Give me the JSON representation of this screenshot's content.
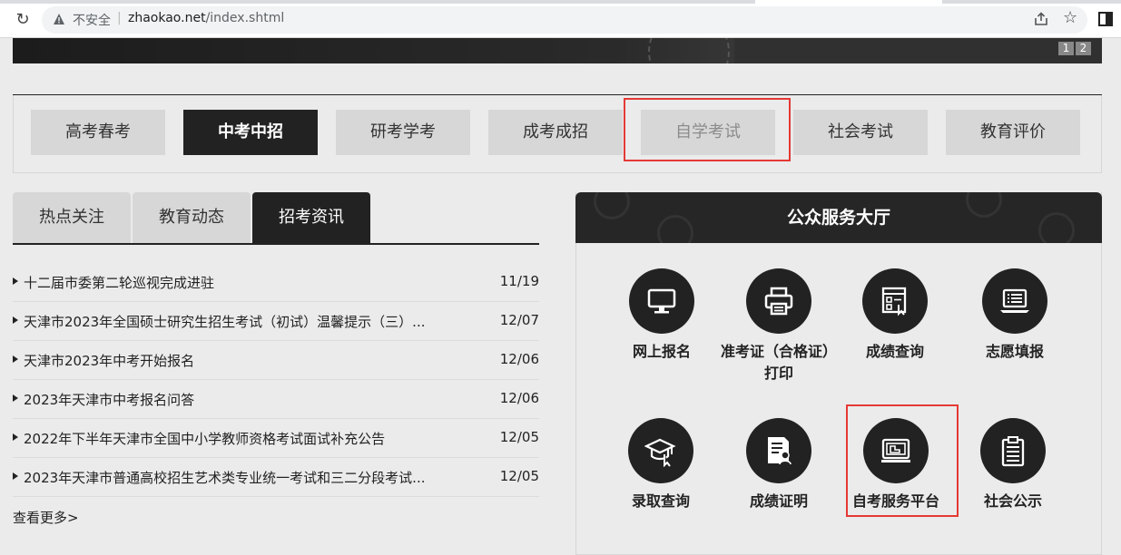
{
  "browser": {
    "insecure_label": "不安全",
    "separator": "|",
    "url_host": "zhaokao.net",
    "url_path": "/index.shtml"
  },
  "banner": {
    "pager": [
      "1",
      "2"
    ]
  },
  "categories": [
    {
      "label": "高考春考",
      "state": "normal"
    },
    {
      "label": "中考中招",
      "state": "active"
    },
    {
      "label": "研考学考",
      "state": "normal"
    },
    {
      "label": "成考成招",
      "state": "normal"
    },
    {
      "label": "自学考试",
      "state": "muted"
    },
    {
      "label": "社会考试",
      "state": "normal"
    },
    {
      "label": "教育评价",
      "state": "normal"
    }
  ],
  "news": {
    "tabs": [
      {
        "label": "热点关注",
        "active": false
      },
      {
        "label": "教育动态",
        "active": false
      },
      {
        "label": "招考资讯",
        "active": true
      }
    ],
    "items": [
      {
        "title": "十二届市委第二轮巡视完成进驻",
        "date": "11/19"
      },
      {
        "title": "天津市2023年全国硕士研究生招生考试（初试）温馨提示（三）...",
        "date": "12/07"
      },
      {
        "title": "天津市2023年中考开始报名",
        "date": "12/06"
      },
      {
        "title": "2023年天津市中考报名问答",
        "date": "12/06"
      },
      {
        "title": "2022年下半年天津市全国中小学教师资格考试面试补充公告",
        "date": "12/05"
      },
      {
        "title": "2023年天津市普通高校招生艺术类专业统一考试和三二分段考试...",
        "date": "12/05"
      }
    ],
    "more_label": "查看更多>"
  },
  "service_hall": {
    "title": "公众服务大厅",
    "services": [
      {
        "label": "网上报名",
        "icon": "monitor-icon"
      },
      {
        "label": "准考证（合格证）打印",
        "icon": "printer-icon"
      },
      {
        "label": "成绩查询",
        "icon": "score-query-icon"
      },
      {
        "label": "志愿填报",
        "icon": "laptop-list-icon"
      },
      {
        "label": "录取查询",
        "icon": "graduation-cap-icon"
      },
      {
        "label": "成绩证明",
        "icon": "certificate-icon"
      },
      {
        "label": "自考服务平台",
        "icon": "self-study-platform-icon"
      },
      {
        "label": "社会公示",
        "icon": "clipboard-icon"
      }
    ]
  },
  "colors": {
    "highlight": "#e53935",
    "active_bg": "#222222",
    "button_bg": "#d7d7d7",
    "page_bg": "#ebebeb"
  }
}
